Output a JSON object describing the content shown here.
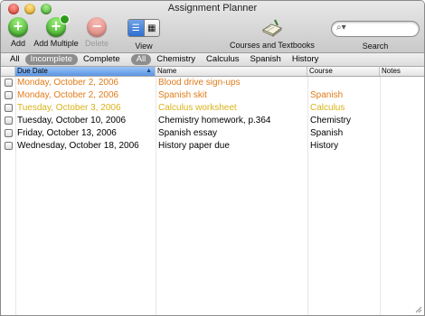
{
  "window": {
    "title": "Assignment Planner"
  },
  "toolbar": {
    "add_label": "Add",
    "add_multiple_label": "Add Multiple",
    "delete_label": "Delete",
    "view_label": "View",
    "courses_label": "Courses and Textbooks",
    "search_label": "Search",
    "search_value": "",
    "search_placeholder": ""
  },
  "filters": {
    "status": [
      "All",
      "Incomplete",
      "Complete"
    ],
    "status_selected": "Incomplete",
    "courses": [
      "All",
      "Chemistry",
      "Calculus",
      "Spanish",
      "History"
    ],
    "course_selected": "All"
  },
  "table": {
    "columns": {
      "due_date": "Due Date",
      "name": "Name",
      "course": "Course",
      "notes": "Notes"
    },
    "sorted_column": "Due Date",
    "rows": [
      {
        "due": "Monday, October 2, 2006",
        "name": "Blood drive sign-ups",
        "course": "",
        "notes": "",
        "color": "#e07b1a"
      },
      {
        "due": "Monday, October 2, 2006",
        "name": "Spanish skit",
        "course": "Spanish",
        "notes": "",
        "color": "#e07b1a"
      },
      {
        "due": "Tuesday, October 3, 2006",
        "name": "Calculus worksheet",
        "course": "Calculus",
        "notes": "",
        "color": "#d9b21a"
      },
      {
        "due": "Tuesday, October 10, 2006",
        "name": "Chemistry homework, p.364",
        "course": "Chemistry",
        "notes": "",
        "color": "#000000"
      },
      {
        "due": "Friday, October 13, 2006",
        "name": "Spanish essay",
        "course": "Spanish",
        "notes": "",
        "color": "#000000"
      },
      {
        "due": "Wednesday, October 18, 2006",
        "name": "History paper due",
        "course": "History",
        "notes": "",
        "color": "#000000"
      }
    ]
  },
  "colors": {
    "accent": "#5b94e2",
    "overdue": "#e07b1a",
    "due_soon": "#d9b21a"
  },
  "icons": {
    "add": "plus-circle-icon",
    "add_multiple": "plus-multiple-icon",
    "delete": "minus-circle-icon",
    "view": "view-toggle-icon",
    "courses": "book-icon",
    "search": "magnifier-icon"
  }
}
